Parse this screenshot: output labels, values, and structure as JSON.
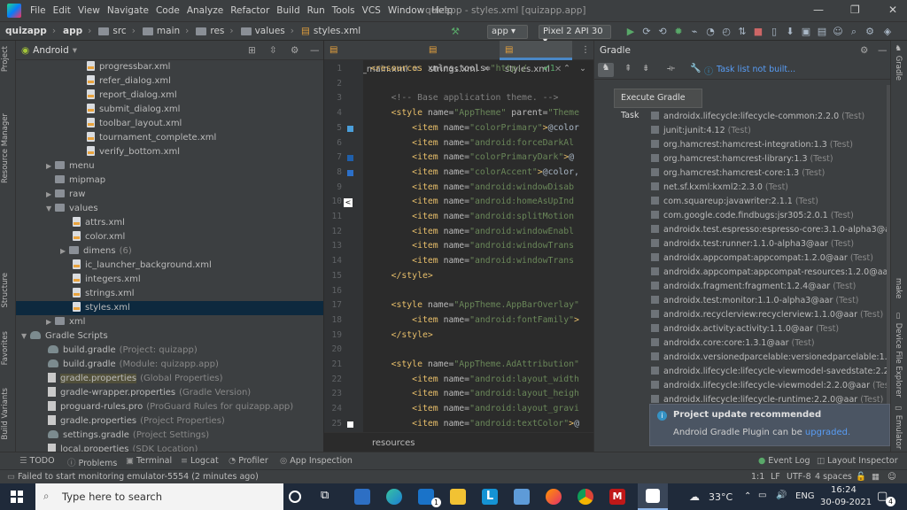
{
  "menubar": {
    "items": [
      "File",
      "Edit",
      "View",
      "Navigate",
      "Code",
      "Analyze",
      "Refactor",
      "Build",
      "Run",
      "Tools",
      "VCS",
      "Window",
      "Help"
    ],
    "title": "quizapp - styles.xml [quizapp.app]"
  },
  "navbar": {
    "crumbs": [
      "quizapp",
      "app",
      "src",
      "main",
      "res",
      "values",
      "styles.xml"
    ],
    "run_config": "app",
    "device": "Pixel 2 API 30"
  },
  "left_strip": {
    "tabs": [
      "Project",
      "Resource Manager",
      "Structure",
      "Favorites",
      "Build Variants"
    ]
  },
  "project": {
    "view": "Android",
    "rows": [
      {
        "kind": "file",
        "label": "progressbar.xml",
        "extra": "",
        "indent": 80
      },
      {
        "kind": "file",
        "label": "refer_dialog.xml",
        "extra": "",
        "indent": 80
      },
      {
        "kind": "file",
        "label": "report_dialog.xml",
        "extra": "",
        "indent": 80
      },
      {
        "kind": "file",
        "label": "submit_dialog.xml",
        "extra": "",
        "indent": 80
      },
      {
        "kind": "file",
        "label": "toolbar_layout.xml",
        "extra": "",
        "indent": 80
      },
      {
        "kind": "file",
        "label": "tournament_complete.xml",
        "extra": "",
        "indent": 80
      },
      {
        "kind": "file",
        "label": "verify_bottom.xml",
        "extra": "",
        "indent": 80
      },
      {
        "kind": "folder",
        "label": "menu",
        "extra": "",
        "indent": 34,
        "arrow": "▶"
      },
      {
        "kind": "folder",
        "label": "mipmap",
        "extra": "",
        "indent": 34,
        "arrow": ""
      },
      {
        "kind": "folder",
        "label": "raw",
        "extra": "",
        "indent": 34,
        "arrow": "▶"
      },
      {
        "kind": "folder",
        "label": "values",
        "extra": "",
        "indent": 34,
        "arrow": "▼"
      },
      {
        "kind": "file",
        "label": "attrs.xml",
        "extra": "",
        "indent": 64
      },
      {
        "kind": "file",
        "label": "color.xml",
        "extra": "",
        "indent": 64
      },
      {
        "kind": "folder",
        "label": "dimens",
        "extra": "(6)",
        "indent": 50,
        "arrow": "▶"
      },
      {
        "kind": "file",
        "label": "ic_launcher_background.xml",
        "extra": "",
        "indent": 64
      },
      {
        "kind": "file",
        "label": "integers.xml",
        "extra": "",
        "indent": 64
      },
      {
        "kind": "file",
        "label": "strings.xml",
        "extra": "",
        "indent": 64
      },
      {
        "kind": "file",
        "label": "styles.xml",
        "extra": "",
        "indent": 64,
        "selected": true
      },
      {
        "kind": "folder",
        "label": "xml",
        "extra": "",
        "indent": 34,
        "arrow": "▶"
      },
      {
        "kind": "grad",
        "label": "Gradle Scripts",
        "extra": "",
        "indent": 6,
        "arrow": "▼"
      },
      {
        "kind": "grad",
        "label": "build.gradle",
        "extra": "(Project: quizapp)",
        "indent": 36
      },
      {
        "kind": "grad",
        "label": "build.gradle",
        "extra": "(Module: quizapp.app)",
        "indent": 36
      },
      {
        "kind": "prop",
        "label": "gradle.properties",
        "extra": "(Global Properties)",
        "indent": 36,
        "highlight": true
      },
      {
        "kind": "prop",
        "label": "gradle-wrapper.properties",
        "extra": "(Gradle Version)",
        "indent": 36
      },
      {
        "kind": "prop",
        "label": "proguard-rules.pro",
        "extra": "(ProGuard Rules for quizapp.app)",
        "indent": 36
      },
      {
        "kind": "prop",
        "label": "gradle.properties",
        "extra": "(Project Properties)",
        "indent": 36
      },
      {
        "kind": "grad",
        "label": "settings.gradle",
        "extra": "(Project Settings)",
        "indent": 36
      },
      {
        "kind": "prop",
        "label": "local.properties",
        "extra": "(SDK Location)",
        "indent": 36
      }
    ]
  },
  "editor": {
    "tabs": [
      "activity_main.xml",
      "strings.xml",
      "styles.xml"
    ],
    "status_crumb": "resources",
    "inspection": "✔1",
    "lines": [
      {
        "n": "1",
        "code": [
          [
            "t-tag",
            "<resources "
          ],
          [
            "t-attr",
            "xmlns:tools="
          ],
          [
            "t-str",
            "\"http:/"
          ]
        ]
      },
      {
        "n": "2",
        "code": []
      },
      {
        "n": "3",
        "code": [
          [
            "t-com",
            "    <!-- Base application theme. -->"
          ]
        ]
      },
      {
        "n": "4",
        "code": [
          [
            "t-tag",
            "    <style "
          ],
          [
            "t-attr",
            "name="
          ],
          [
            "t-str",
            "\"AppTheme\" "
          ],
          [
            "t-attr",
            "parent="
          ],
          [
            "t-str",
            "\"Theme"
          ]
        ]
      },
      {
        "n": "5",
        "code": [
          [
            "t-tag",
            "        <item "
          ],
          [
            "t-attr",
            "name="
          ],
          [
            "t-str",
            "\"colorPrimary\""
          ],
          [
            "t-tag",
            ">"
          ],
          [
            "",
            "@color"
          ]
        ]
      },
      {
        "n": "6",
        "code": [
          [
            "t-tag",
            "        <item "
          ],
          [
            "t-attr",
            "name="
          ],
          [
            "t-str",
            "\"android:forceDarkAl"
          ]
        ]
      },
      {
        "n": "7",
        "code": [
          [
            "t-tag",
            "        <item "
          ],
          [
            "t-attr",
            "name="
          ],
          [
            "t-str",
            "\"colorPrimaryDark\""
          ],
          [
            "t-tag",
            ">"
          ],
          [
            "",
            "@"
          ]
        ]
      },
      {
        "n": "8",
        "code": [
          [
            "t-tag",
            "        <item "
          ],
          [
            "t-attr",
            "name="
          ],
          [
            "t-str",
            "\"colorAccent\""
          ],
          [
            "t-tag",
            ">"
          ],
          [
            "",
            "@color,"
          ]
        ]
      },
      {
        "n": "9",
        "code": [
          [
            "t-tag",
            "        <item "
          ],
          [
            "t-attr",
            "name="
          ],
          [
            "t-str",
            "\"android:windowDisab"
          ]
        ]
      },
      {
        "n": "10",
        "code": [
          [
            "t-tag",
            "        <item "
          ],
          [
            "t-attr",
            "name="
          ],
          [
            "t-str",
            "\"android:homeAsUpInd"
          ]
        ]
      },
      {
        "n": "11",
        "code": [
          [
            "t-tag",
            "        <item "
          ],
          [
            "t-attr",
            "name="
          ],
          [
            "t-str",
            "\"android:splitMotion"
          ]
        ]
      },
      {
        "n": "12",
        "code": [
          [
            "t-tag",
            "        <item "
          ],
          [
            "t-attr",
            "name="
          ],
          [
            "t-str",
            "\"android:windowEnabl"
          ]
        ]
      },
      {
        "n": "13",
        "code": [
          [
            "t-tag",
            "        <item "
          ],
          [
            "t-attr",
            "name="
          ],
          [
            "t-str",
            "\"android:windowTrans"
          ]
        ]
      },
      {
        "n": "14",
        "code": [
          [
            "t-tag",
            "        <item "
          ],
          [
            "t-attr",
            "name="
          ],
          [
            "t-str",
            "\"android:windowTrans"
          ]
        ]
      },
      {
        "n": "15",
        "code": [
          [
            "t-tag",
            "    </style>"
          ]
        ]
      },
      {
        "n": "16",
        "code": []
      },
      {
        "n": "17",
        "code": [
          [
            "t-tag",
            "    <style "
          ],
          [
            "t-attr",
            "name="
          ],
          [
            "t-str",
            "\"AppTheme.AppBarOverlay\""
          ]
        ]
      },
      {
        "n": "18",
        "code": [
          [
            "t-tag",
            "        <item "
          ],
          [
            "t-attr",
            "name="
          ],
          [
            "t-str",
            "\"android:fontFamily\""
          ],
          [
            "t-tag",
            ">"
          ]
        ]
      },
      {
        "n": "19",
        "code": [
          [
            "t-tag",
            "    </style>"
          ]
        ]
      },
      {
        "n": "20",
        "code": []
      },
      {
        "n": "21",
        "code": [
          [
            "t-tag",
            "    <style "
          ],
          [
            "t-attr",
            "name="
          ],
          [
            "t-str",
            "\"AppTheme.AdAttribution\""
          ]
        ]
      },
      {
        "n": "22",
        "code": [
          [
            "t-tag",
            "        <item "
          ],
          [
            "t-attr",
            "name="
          ],
          [
            "t-str",
            "\"android:layout_width"
          ]
        ]
      },
      {
        "n": "23",
        "code": [
          [
            "t-tag",
            "        <item "
          ],
          [
            "t-attr",
            "name="
          ],
          [
            "t-str",
            "\"android:layout_heigh"
          ]
        ]
      },
      {
        "n": "24",
        "code": [
          [
            "t-tag",
            "        <item "
          ],
          [
            "t-attr",
            "name="
          ],
          [
            "t-str",
            "\"android:layout_gravi"
          ]
        ]
      },
      {
        "n": "25",
        "code": [
          [
            "t-tag",
            "        <item "
          ],
          [
            "t-attr",
            "name="
          ],
          [
            "t-str",
            "\"android:textColor\""
          ],
          [
            "t-tag",
            ">"
          ],
          [
            "",
            "@"
          ]
        ]
      }
    ]
  },
  "gradle": {
    "title": "Gradle",
    "task_list": "Task list not built...",
    "tooltip": "Execute Gradle Task",
    "deps": [
      {
        "name": "androidx.lifecycle:lifecycle-common:2.2.0",
        "scope": "(Test)"
      },
      {
        "name": "junit:junit:4.12",
        "scope": "(Test)"
      },
      {
        "name": "org.hamcrest:hamcrest-integration:1.3",
        "scope": "(Test)"
      },
      {
        "name": "org.hamcrest:hamcrest-library:1.3",
        "scope": "(Test)"
      },
      {
        "name": "org.hamcrest:hamcrest-core:1.3",
        "scope": "(Test)"
      },
      {
        "name": "net.sf.kxml:kxml2:2.3.0",
        "scope": "(Test)"
      },
      {
        "name": "com.squareup:javawriter:2.1.1",
        "scope": "(Test)"
      },
      {
        "name": "com.google.code.findbugs:jsr305:2.0.1",
        "scope": "(Test)"
      },
      {
        "name": "androidx.test.espresso:espresso-core:3.1.0-alpha3@aar",
        "scope": "(Test)"
      },
      {
        "name": "androidx.test:runner:1.1.0-alpha3@aar",
        "scope": "(Test)"
      },
      {
        "name": "androidx.appcompat:appcompat:1.2.0@aar",
        "scope": "(Test)"
      },
      {
        "name": "androidx.appcompat:appcompat-resources:1.2.0@aar",
        "scope": "(Test)"
      },
      {
        "name": "androidx.fragment:fragment:1.2.4@aar",
        "scope": "(Test)"
      },
      {
        "name": "androidx.test:monitor:1.1.0-alpha3@aar",
        "scope": "(Test)"
      },
      {
        "name": "androidx.recyclerview:recyclerview:1.1.0@aar",
        "scope": "(Test)"
      },
      {
        "name": "androidx.activity:activity:1.1.0@aar",
        "scope": "(Test)"
      },
      {
        "name": "androidx.core:core:1.3.1@aar",
        "scope": "(Test)"
      },
      {
        "name": "androidx.versionedparcelable:versionedparcelable:1.1.0@aar",
        "scope": "(Test)"
      },
      {
        "name": "androidx.lifecycle:lifecycle-viewmodel-savedstate:2.2.0@aar",
        "scope": "(Test)"
      },
      {
        "name": "androidx.lifecycle:lifecycle-viewmodel:2.2.0@aar",
        "scope": "(Test)"
      },
      {
        "name": "androidx.lifecycle:lifecycle-runtime:2.2.0@aar",
        "scope": "(Test)"
      }
    ],
    "notification": {
      "title": "Project update recommended",
      "body": "Android Gradle Plugin can be",
      "link": "upgraded."
    }
  },
  "right_strip": {
    "tabs": [
      "Gradle",
      "make",
      "Device File Explorer",
      "Emulator"
    ]
  },
  "bottom_tools": {
    "left": [
      "TODO",
      "Problems",
      "Terminal",
      "Logcat",
      "Profiler",
      "App Inspection"
    ],
    "right": [
      "Event Log",
      "Layout Inspector"
    ]
  },
  "status": {
    "message": "Failed to start monitoring emulator-5554 (2 minutes ago)",
    "position": "1:1",
    "line_sep": "LF",
    "encoding": "UTF-8",
    "indent": "4 spaces"
  },
  "taskbar": {
    "search_placeholder": "Type here to search",
    "weather": "33°C",
    "lang": "ENG",
    "time": "16:24",
    "date": "30-09-2021",
    "mail_badge": "1",
    "notif_badge": "4"
  },
  "colors": {
    "accent": "#4a88c7",
    "selection": "#0d293e",
    "run_green": "#59a869"
  }
}
